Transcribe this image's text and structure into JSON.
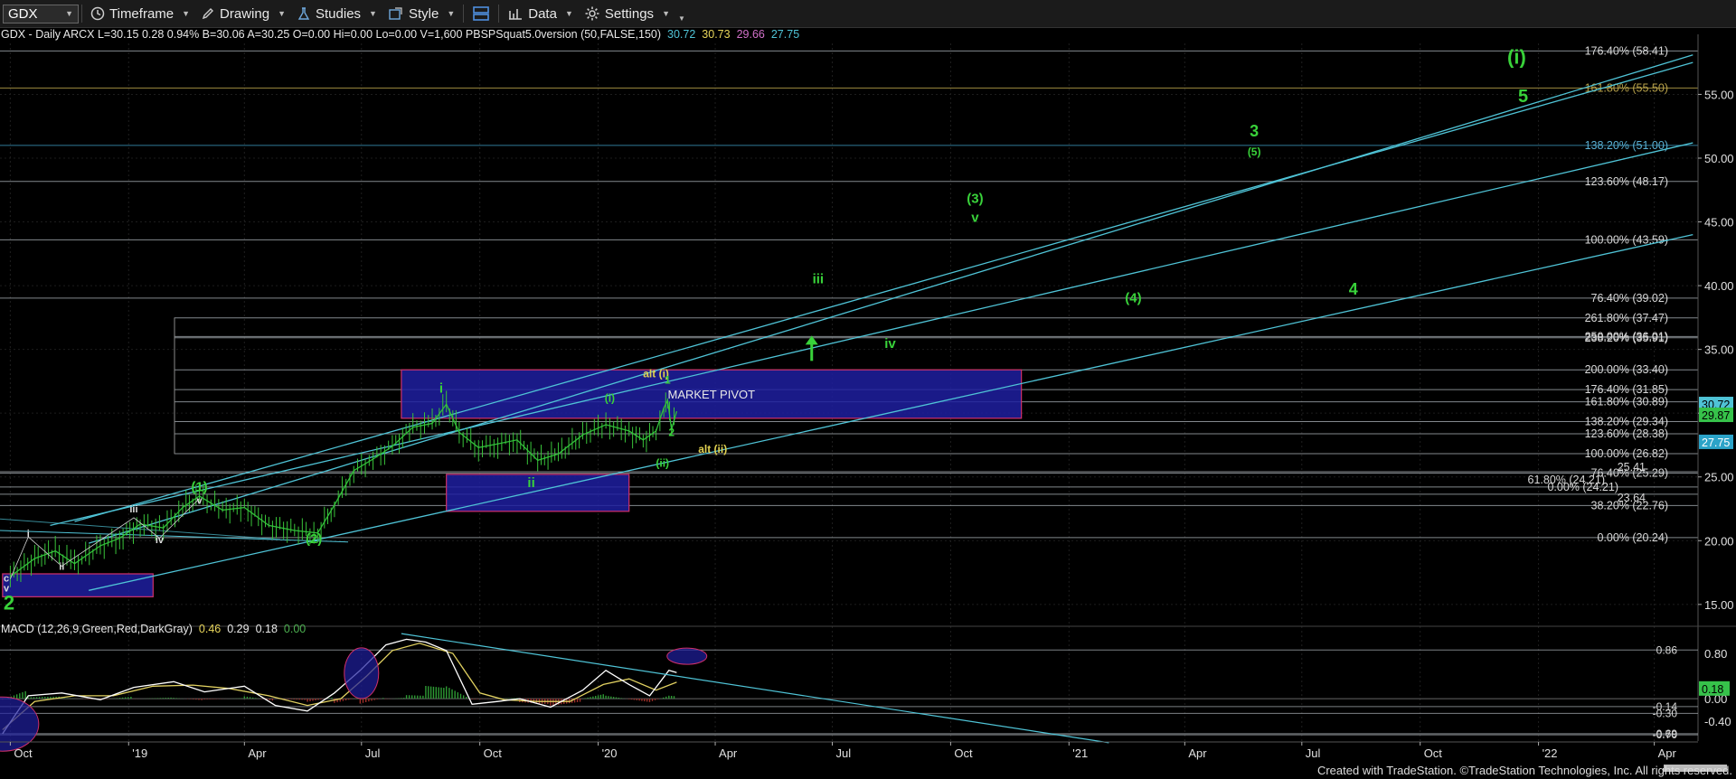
{
  "toolbar": {
    "symbol": "GDX",
    "items": [
      {
        "icon": "clock-icon",
        "label": "Timeframe"
      },
      {
        "icon": "pencil-icon",
        "label": "Drawing"
      },
      {
        "icon": "flask-icon",
        "label": "Studies"
      },
      {
        "icon": "style-icon",
        "label": "Style"
      },
      {
        "icon": "layout-icon",
        "label": ""
      },
      {
        "icon": "bar-chart-icon",
        "label": "Data"
      },
      {
        "icon": "gear-icon",
        "label": "Settings"
      }
    ]
  },
  "info_line": {
    "prefix": "GDX - Daily  ARCX  L=30.15  0.28  0.94%  B=30.06  A=30.25  O=0.00  Hi=0.00  Lo=0.00  V=1,600  PBSPSquat5.0version (50,FALSE,150)",
    "values": [
      {
        "text": "30.72",
        "color": "#4fc3d6"
      },
      {
        "text": "30.73",
        "color": "#e8d55a"
      },
      {
        "text": "29.66",
        "color": "#d070c8"
      },
      {
        "text": "27.75",
        "color": "#4fc3d6"
      }
    ]
  },
  "macd_line": {
    "prefix": "MACD (12,26,9,Green,Red,DarkGray)",
    "values": [
      {
        "text": "0.46",
        "color": "#e8d55a"
      },
      {
        "text": "0.29",
        "color": "#e8e8e8"
      },
      {
        "text": "0.18",
        "color": "#e8e8e8"
      },
      {
        "text": "0.00",
        "color": "#4caf50"
      }
    ]
  },
  "chart_data": {
    "type": "line",
    "title": "GDX - Daily",
    "x_tick_labels": [
      "Oct",
      "'19",
      "Apr",
      "Jul",
      "Oct",
      "'20",
      "Apr",
      "Jul",
      "Oct",
      "'21",
      "Apr",
      "Jul",
      "Oct",
      "'22",
      "Apr"
    ],
    "y_axis": {
      "ticks": [
        15,
        20,
        25,
        30,
        35,
        40,
        45,
        50,
        55
      ],
      "tick_labels": [
        "15.00",
        "20.00",
        "25.00",
        "30.00",
        "35.00",
        "40.00",
        "45.00",
        "50.00",
        "55.00"
      ],
      "range": [
        13.5,
        59
      ]
    },
    "price_series": {
      "name": "GDX",
      "points": [
        [
          "2018-10-01",
          17.2
        ],
        [
          "2018-10-20",
          18.6
        ],
        [
          "2018-11-05",
          19.2
        ],
        [
          "2018-11-20",
          18.2
        ],
        [
          "2018-12-10",
          19.6
        ],
        [
          "2018-12-25",
          20.2
        ],
        [
          "2019-01-10",
          21.3
        ],
        [
          "2019-01-28",
          21.0
        ],
        [
          "2019-02-12",
          22.6
        ],
        [
          "2019-02-25",
          23.5
        ],
        [
          "2019-03-15",
          22.4
        ],
        [
          "2019-04-01",
          22.6
        ],
        [
          "2019-04-20",
          21.2
        ],
        [
          "2019-05-10",
          20.8
        ],
        [
          "2019-05-28",
          20.6
        ],
        [
          "2019-06-10",
          22.8
        ],
        [
          "2019-06-25",
          25.5
        ],
        [
          "2019-07-10",
          26.4
        ],
        [
          "2019-07-25",
          27.4
        ],
        [
          "2019-08-10",
          28.9
        ],
        [
          "2019-08-25",
          29.2
        ],
        [
          "2019-09-05",
          30.7
        ],
        [
          "2019-09-15",
          28.5
        ],
        [
          "2019-09-30",
          27.3
        ],
        [
          "2019-10-15",
          27.6
        ],
        [
          "2019-10-30",
          27.9
        ],
        [
          "2019-11-15",
          26.3
        ],
        [
          "2019-12-01",
          26.8
        ],
        [
          "2019-12-20",
          28.3
        ],
        [
          "2020-01-07",
          29.1
        ],
        [
          "2020-01-25",
          28.6
        ],
        [
          "2020-02-05",
          27.9
        ],
        [
          "2020-02-15",
          28.6
        ],
        [
          "2020-02-21",
          30.4
        ],
        [
          "2020-02-24",
          31.0
        ],
        [
          "2020-02-27",
          28.7
        ],
        [
          "2020-03-02",
          30.15
        ]
      ]
    },
    "horizontal_levels": [
      {
        "label": "176.40% (58.41)",
        "value": 58.41
      },
      {
        "label": "161.80% (55.50)",
        "value": 55.5,
        "color": "#b8a24a"
      },
      {
        "label": "138.20% (51.00)",
        "value": 51.0,
        "color": "#3a8fb3"
      },
      {
        "label": "123.60% (48.17)",
        "value": 48.17
      },
      {
        "label": "100.00% (43.59)",
        "value": 43.59
      },
      {
        "label": "76.40% (39.02)",
        "value": 39.02
      },
      {
        "label": "261.80% (37.47)",
        "value": 37.47
      },
      {
        "label": "250.00% (36.01)",
        "value": 36.01
      },
      {
        "label": "238.20% (35.91)",
        "value": 35.91
      },
      {
        "label": "200.00% (33.40)",
        "value": 33.4
      },
      {
        "label": "176.40% (31.85)",
        "value": 31.85
      },
      {
        "label": "161.80% (30.89)",
        "value": 30.89
      },
      {
        "label": "138.20% (29.34)",
        "value": 29.34
      },
      {
        "label": "123.60% (28.38)",
        "value": 28.38
      },
      {
        "label": "100.00% (26.82)",
        "value": 26.82
      },
      {
        "label": "76.40% (25.29)",
        "value": 25.29
      },
      {
        "label": "25.41",
        "value": 25.41
      },
      {
        "label": "61.80% (24.21)",
        "value": 24.21
      },
      {
        "label": "0.00% (24.21)",
        "value": 24.21
      },
      {
        "label": "23.64",
        "value": 23.64
      },
      {
        "label": "38.20% (22.76)",
        "value": 22.76
      },
      {
        "label": "0.00% (20.24)",
        "value": 20.24
      }
    ],
    "price_tags": [
      {
        "text": "30.72",
        "value": 30.72,
        "color": "#4fc3d6",
        "text_color": "#000"
      },
      {
        "text": "29.87",
        "value": 29.87,
        "color": "#36c24a",
        "text_color": "#000"
      },
      {
        "text": "27.75",
        "value": 27.75,
        "color": "#2ba3c8",
        "text_color": "#fff"
      }
    ],
    "zones": [
      {
        "label": "MARKET PIVOT",
        "from": "2019-08-01",
        "to": "2020-11-25",
        "low": 29.6,
        "high": 33.4
      },
      {
        "label": "",
        "from": "2019-09-05",
        "to": "2020-01-25",
        "low": 22.3,
        "high": 25.2
      },
      {
        "label": "",
        "from": "2018-09-25",
        "to": "2019-01-20",
        "low": 15.6,
        "high": 17.4
      }
    ],
    "channel_lines": [
      {
        "from": [
          "2018-12-01",
          19.8
        ],
        "to": [
          "2022-05-01",
          58.1
        ]
      },
      {
        "from": [
          "2018-11-20",
          21.5
        ],
        "to": [
          "2022-05-01",
          57.5
        ]
      },
      {
        "from": [
          "2018-11-01",
          21.2
        ],
        "to": [
          "2022-05-01",
          51.2
        ]
      },
      {
        "from": [
          "2018-12-01",
          16.1
        ],
        "to": [
          "2022-05-01",
          44.0
        ]
      }
    ],
    "wave_labels": [
      {
        "text": "(i)",
        "date": "2021-12-15",
        "value": 57.4,
        "color": "#39d23a",
        "size": 22
      },
      {
        "text": "5",
        "date": "2021-12-20",
        "value": 54.4,
        "color": "#39d23a",
        "size": 20
      },
      {
        "text": "3",
        "date": "2021-05-25",
        "value": 51.7,
        "color": "#39d23a",
        "size": 18
      },
      {
        "text": "(5)",
        "date": "2021-05-25",
        "value": 50.2,
        "color": "#39d23a",
        "size": 12
      },
      {
        "text": "(3)",
        "date": "2020-10-20",
        "value": 46.5,
        "color": "#39d23a",
        "size": 15
      },
      {
        "text": "v",
        "date": "2020-10-20",
        "value": 45.0,
        "color": "#39d23a",
        "size": 15
      },
      {
        "text": "iii",
        "date": "2020-06-20",
        "value": 40.2,
        "color": "#39d23a",
        "size": 15
      },
      {
        "text": "(4)",
        "date": "2021-02-20",
        "value": 38.7,
        "color": "#39d23a",
        "size": 15
      },
      {
        "text": "4",
        "date": "2021-08-10",
        "value": 39.3,
        "color": "#39d23a",
        "size": 18
      },
      {
        "text": "iv",
        "date": "2020-08-15",
        "value": 35.1,
        "color": "#39d23a",
        "size": 15
      },
      {
        "text": "alt (i)",
        "date": "2020-02-15",
        "value": 32.8,
        "color": "#e0d050",
        "size": 12
      },
      {
        "text": "1",
        "date": "2020-02-24",
        "value": 32.3,
        "color": "#39d23a",
        "size": 12
      },
      {
        "text": "i",
        "date": "2019-09-01",
        "value": 31.6,
        "color": "#39d23a",
        "size": 15
      },
      {
        "text": "(i)",
        "date": "2020-01-10",
        "value": 30.9,
        "color": "#39d23a",
        "size": 12
      },
      {
        "text": "2",
        "date": "2020-02-27",
        "value": 28.2,
        "color": "#39d23a",
        "size": 12
      },
      {
        "text": "alt (ii)",
        "date": "2020-03-30",
        "value": 26.9,
        "color": "#e0d050",
        "size": 12
      },
      {
        "text": "(ii)",
        "date": "2020-02-20",
        "value": 25.8,
        "color": "#39d23a",
        "size": 12
      },
      {
        "text": "ii",
        "date": "2019-11-10",
        "value": 24.2,
        "color": "#39d23a",
        "size": 15
      },
      {
        "text": "(1)",
        "date": "2019-02-25",
        "value": 23.9,
        "color": "#39d23a",
        "size": 15
      },
      {
        "text": "v",
        "date": "2019-02-25",
        "value": 22.9,
        "color": "#ddd",
        "size": 11
      },
      {
        "text": "iii",
        "date": "2019-01-05",
        "value": 22.2,
        "color": "#ddd",
        "size": 11
      },
      {
        "text": "iv",
        "date": "2019-01-25",
        "value": 19.8,
        "color": "#ddd",
        "size": 11
      },
      {
        "text": "(2)",
        "date": "2019-05-25",
        "value": 19.8,
        "color": "#39d23a",
        "size": 15
      },
      {
        "text": "i",
        "date": "2018-10-15",
        "value": 20.3,
        "color": "#ddd",
        "size": 11
      },
      {
        "text": "ii",
        "date": "2018-11-10",
        "value": 17.7,
        "color": "#ddd",
        "size": 11
      },
      {
        "text": "c",
        "date": "2018-09-28",
        "value": 16.8,
        "color": "#ddd",
        "size": 11
      },
      {
        "text": "v",
        "date": "2018-09-28",
        "value": 16.0,
        "color": "#ddd",
        "size": 11
      },
      {
        "text": "2",
        "date": "2018-09-30",
        "value": 14.6,
        "color": "#39d23a",
        "size": 22
      }
    ],
    "up_arrow": {
      "date": "2020-06-15",
      "from": 34.1,
      "to": 35.8,
      "color": "#39d23a"
    },
    "macd": {
      "y_axis": {
        "tick_labels": [
          "0.80",
          "0.00",
          "-0.40"
        ],
        "ticks": [
          0.8,
          0.0,
          -0.4
        ],
        "range": [
          -0.75,
          1.2
        ]
      },
      "levels": [
        {
          "label": "0.86",
          "value": 0.86
        },
        {
          "label": "-0.14",
          "value": -0.14
        },
        {
          "label": "-0.30",
          "value": -0.26
        },
        {
          "label": "-0.69",
          "value": -0.62
        },
        {
          "label": "-0.70",
          "value": -0.64
        }
      ],
      "value_tag": {
        "text": "0.18",
        "value": 0.18
      },
      "macd_series": [
        [
          "2018-09-25",
          -0.62
        ],
        [
          "2018-10-15",
          0.05
        ],
        [
          "2018-11-10",
          0.1
        ],
        [
          "2018-12-10",
          -0.02
        ],
        [
          "2019-01-05",
          0.2
        ],
        [
          "2019-02-05",
          0.3
        ],
        [
          "2019-03-01",
          0.12
        ],
        [
          "2019-04-01",
          0.22
        ],
        [
          "2019-04-25",
          -0.12
        ],
        [
          "2019-05-20",
          -0.22
        ],
        [
          "2019-06-10",
          0.1
        ],
        [
          "2019-06-30",
          0.5
        ],
        [
          "2019-07-20",
          0.95
        ],
        [
          "2019-08-05",
          1.05
        ],
        [
          "2019-08-20",
          1.0
        ],
        [
          "2019-09-05",
          0.85
        ],
        [
          "2019-09-25",
          -0.1
        ],
        [
          "2019-10-15",
          -0.05
        ],
        [
          "2019-11-01",
          0.0
        ],
        [
          "2019-11-25",
          -0.15
        ],
        [
          "2019-12-20",
          0.15
        ],
        [
          "2020-01-07",
          0.5
        ],
        [
          "2020-01-25",
          0.25
        ],
        [
          "2020-02-10",
          0.05
        ],
        [
          "2020-02-25",
          0.5
        ],
        [
          "2020-03-02",
          0.46
        ]
      ],
      "signal_series": [
        [
          "2018-09-25",
          -0.55
        ],
        [
          "2018-10-20",
          -0.05
        ],
        [
          "2018-11-20",
          0.05
        ],
        [
          "2018-12-20",
          0.05
        ],
        [
          "2019-01-20",
          0.22
        ],
        [
          "2019-02-20",
          0.24
        ],
        [
          "2019-03-20",
          0.18
        ],
        [
          "2019-04-20",
          0.05
        ],
        [
          "2019-05-20",
          -0.12
        ],
        [
          "2019-06-15",
          0.0
        ],
        [
          "2019-07-05",
          0.4
        ],
        [
          "2019-07-25",
          0.85
        ],
        [
          "2019-08-15",
          0.98
        ],
        [
          "2019-09-10",
          0.8
        ],
        [
          "2019-10-01",
          0.1
        ],
        [
          "2019-10-20",
          -0.02
        ],
        [
          "2019-11-15",
          -0.05
        ],
        [
          "2019-12-10",
          -0.05
        ],
        [
          "2020-01-05",
          0.25
        ],
        [
          "2020-01-25",
          0.35
        ],
        [
          "2020-02-15",
          0.15
        ],
        [
          "2020-03-02",
          0.29
        ]
      ],
      "trendline": {
        "from": [
          "2019-08-01",
          1.15
        ],
        "to": [
          "2021-02-01",
          -0.78
        ]
      }
    }
  },
  "footer": "Created with TradeStation. ©TradeStation Technologies, Inc. All rights reserved."
}
